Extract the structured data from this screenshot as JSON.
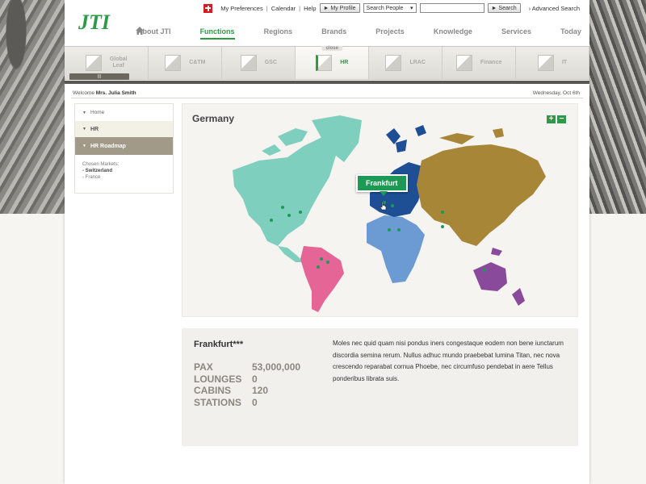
{
  "header": {
    "logo_text": "JTI",
    "utility": {
      "preferences": "My Preferences",
      "calendar": "Calendar",
      "help": "Help",
      "profile_button": "My Profile",
      "search_scope": "Search People",
      "search_button": "Search",
      "advanced_search": "Advanced Search"
    },
    "nav": [
      "About JTI",
      "Functions",
      "Regions",
      "Brands",
      "Projects",
      "Knowledge",
      "Services",
      "Today"
    ],
    "active_nav": "Functions"
  },
  "subnav": {
    "items": [
      {
        "label_line1": "Global",
        "label_line2": "Leaf"
      },
      {
        "label_line1": "C&TM",
        "label_line2": ""
      },
      {
        "label_line1": "GSC",
        "label_line2": ""
      },
      {
        "label_line1": "HR",
        "label_line2": ""
      },
      {
        "label_line1": "LRAC",
        "label_line2": ""
      },
      {
        "label_line1": "Finance",
        "label_line2": ""
      },
      {
        "label_line1": "IT",
        "label_line2": ""
      }
    ],
    "active": "HR",
    "close_label": "close"
  },
  "welcome": {
    "prefix": "Welcome",
    "user": "Mrs. Julia Smith",
    "date": "Wednesday, Oct 6th"
  },
  "sidebar": {
    "home": "Home",
    "hr": "HR",
    "roadmap": "HR Roadmap",
    "markets_title": "Chosen Markets:",
    "markets": [
      "- Switzerland",
      "- France"
    ]
  },
  "map": {
    "title": "Germany",
    "tooltip": "Frankfurt",
    "zoom_in": "+",
    "zoom_out": "−",
    "colors": {
      "north_america": "#7fcfbf",
      "south_america": "#e56596",
      "europe": "#1e4f94",
      "africa": "#6b9bd2",
      "asia": "#a88638",
      "oceania": "#8a4a9c",
      "greenland": "#7fcfbf",
      "markers": "#1c9a55"
    }
  },
  "info": {
    "title": "Frankfurt***",
    "stats": [
      {
        "label": "PAX",
        "value": "53,000,000"
      },
      {
        "label": "LOUNGES",
        "value": "0"
      },
      {
        "label": "CABINS",
        "value": "120"
      },
      {
        "label": "STATIONS",
        "value": "0"
      }
    ],
    "description": "Moles nec quid quam nisi pondus iners congestaque eodem non bene iunctarum discordia semina rerum. Nullus adhuc mundo praebebat lumina Titan, nec nova crescendo reparabat cornua Phoebe, nec circumfuso pendebat in aere Tellus ponderibus librata suis."
  }
}
